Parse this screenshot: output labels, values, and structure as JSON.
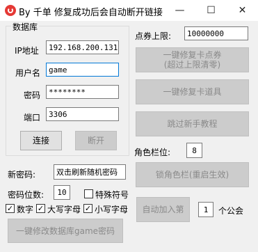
{
  "window": {
    "title": "By 千单  修复成功后会自动断开链接",
    "minimize": "—",
    "maximize": "☐",
    "close": "✕"
  },
  "database": {
    "group_title": "数据库",
    "ip_label": "IP地址",
    "ip_value": "192.168.200.131",
    "user_label": "用户名",
    "user_value": "game",
    "password_label": "密码",
    "password_value": "********",
    "port_label": "端口",
    "port_value": "3306",
    "connect_button": "连接",
    "disconnect_button": "断开"
  },
  "voucher": {
    "label": "点券上限:",
    "value": "10000000",
    "repair_voucher_button": "一键修复卡点券\n(超过上限清零)",
    "repair_items_button": "一键修复卡道具",
    "skip_tutorial_button": "跳过新手教程"
  },
  "role_slot": {
    "label": "角色栏位:",
    "value": "8",
    "lock_button": "锁角色栏(重启生效)"
  },
  "password_tool": {
    "new_password_label": "新密码:",
    "new_password_value": "双击刷新随机密码",
    "digits_label": "密码位数:",
    "digits_value": "10",
    "special_label": "特殊符号",
    "special_checked": false,
    "number_label": "数字",
    "number_checked": true,
    "upper_label": "大写字母",
    "upper_checked": true,
    "lower_label": "小写字母",
    "lower_checked": true,
    "modify_button": "一键修改数据库game密码"
  },
  "guild": {
    "auto_join_button": "自动加入第",
    "index_value": "1",
    "suffix_label": "个公会"
  }
}
